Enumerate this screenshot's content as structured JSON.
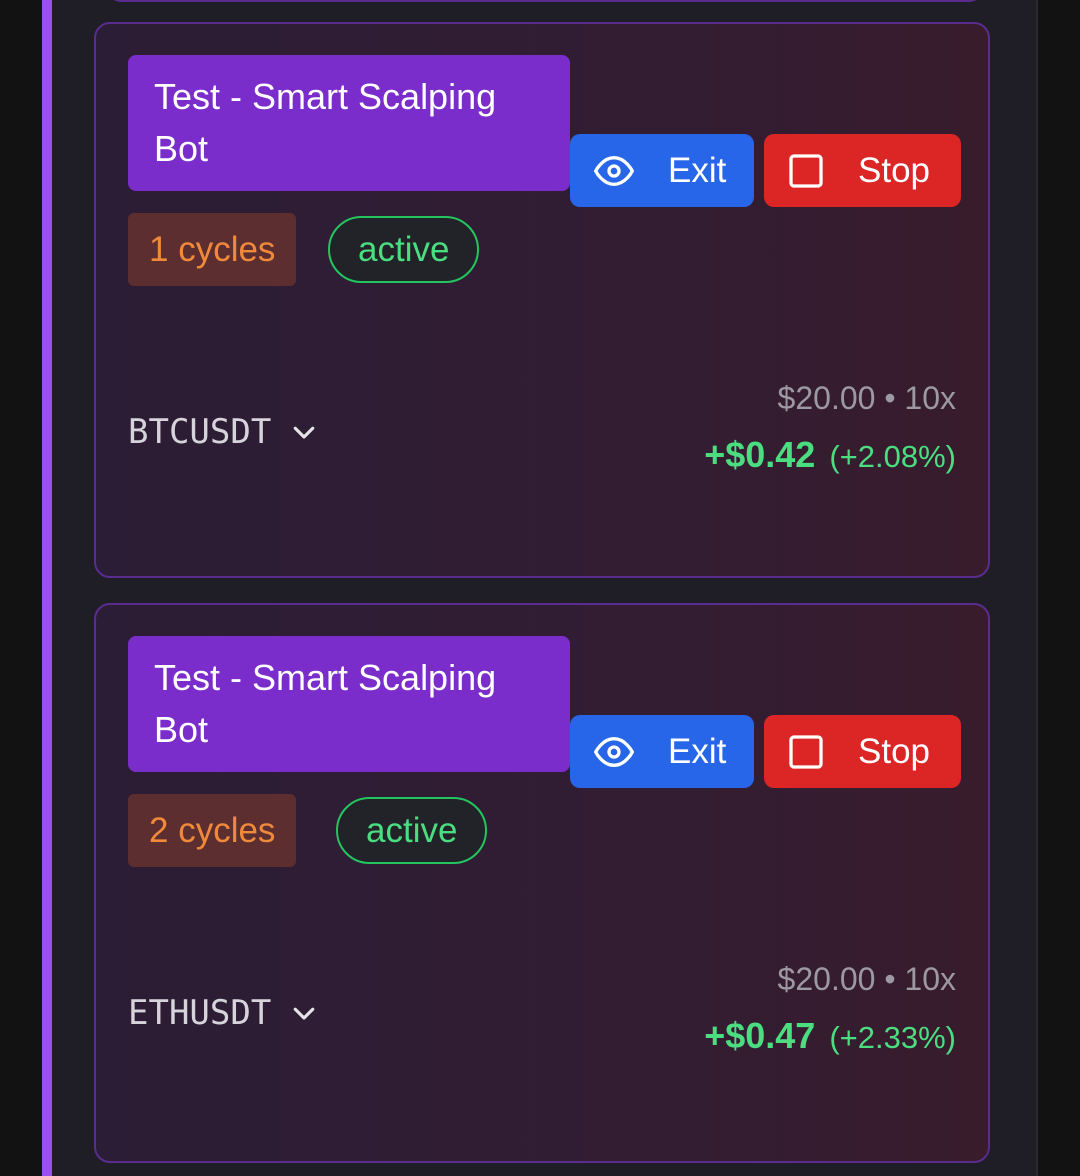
{
  "bots": [
    {
      "title": "Test - Smart Scalping Bot",
      "exit_label": "Exit",
      "stop_label": "Stop",
      "cycles": "1 cycles",
      "status": "active",
      "symbol": "BTCUSDT",
      "meta": "$20.00 • 10x",
      "pnl": "+$0.42",
      "pnl_pct": "(+2.08%)"
    },
    {
      "title": "Test - Smart Scalping Bot",
      "exit_label": "Exit",
      "stop_label": "Stop",
      "cycles": "2 cycles",
      "status": "active",
      "symbol": "ETHUSDT",
      "meta": "$20.00 • 10x",
      "pnl": "+$0.47",
      "pnl_pct": "(+2.33%)"
    }
  ],
  "icons": {
    "exit": "eye-icon",
    "stop": "stop-square-icon",
    "expand": "chevron-down-icon"
  },
  "colors": {
    "accent": "#9a4ff0",
    "title_bg": "#7b2dcc",
    "exit_bg": "#2766e8",
    "stop_bg": "#dc2626",
    "profit": "#4ade80",
    "cycles_text": "#f08a3a"
  }
}
